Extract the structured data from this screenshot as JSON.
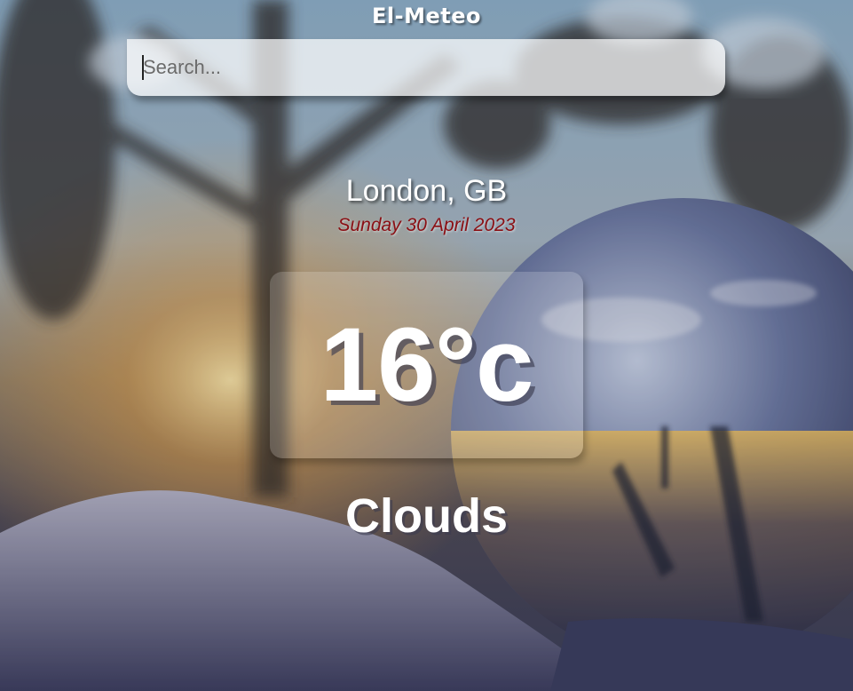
{
  "app": {
    "title": "El-Meteo"
  },
  "search": {
    "placeholder": "Search...",
    "value": ""
  },
  "weather": {
    "location": "London, GB",
    "date": "Sunday 30 April 2023",
    "temperature": "16°c",
    "condition": "Clouds"
  },
  "colors": {
    "date_text": "#8a0f14",
    "title_text": "#ffffff"
  },
  "background": {
    "description_icon": "winter-crystal-ball-photo"
  }
}
